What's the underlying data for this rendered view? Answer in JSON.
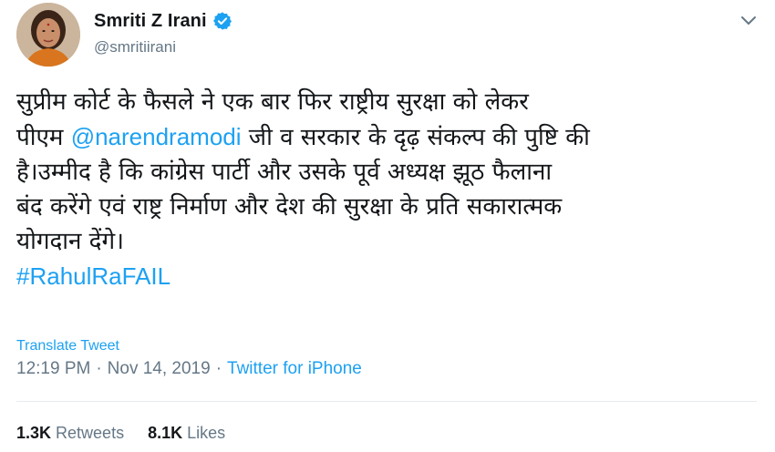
{
  "author": {
    "display_name": "Smriti Z Irani",
    "handle": "@smritiirani",
    "verified": true,
    "verified_color": "#1da1f2"
  },
  "tweet": {
    "lines": [
      {
        "segments": [
          {
            "type": "text",
            "value": "सुप्रीम कोर्ट के फैसले ने एक बार फिर राष्ट्रीय सुरक्षा को लेकर"
          }
        ]
      },
      {
        "segments": [
          {
            "type": "text",
            "value": "पीएम "
          },
          {
            "type": "mention",
            "value": "@narendramodi"
          },
          {
            "type": "text",
            "value": " जी व सरकार के दृढ़ संकल्प की पुष्टि की"
          }
        ]
      },
      {
        "segments": [
          {
            "type": "text",
            "value": "है।उम्मीद है कि कांग्रेस पार्टी और उसके पूर्व अध्यक्ष झूठ फैलाना"
          }
        ]
      },
      {
        "segments": [
          {
            "type": "text",
            "value": "बंद करेंगे एवं राष्ट्र निर्माण और देश की सुरक्षा के प्रति सकारात्मक"
          }
        ]
      },
      {
        "segments": [
          {
            "type": "text",
            "value": "योगदान देंगे।"
          }
        ]
      }
    ],
    "hashtag": "#RahulRaFAIL",
    "link_color": "#1da1f2"
  },
  "translate_label": "Translate Tweet",
  "meta": {
    "time": "12:19 PM",
    "separator": "·",
    "date": "Nov 14, 2019",
    "source": "Twitter for iPhone"
  },
  "stats": {
    "retweets_count": "1.3K",
    "retweets_label": "Retweets",
    "likes_count": "8.1K",
    "likes_label": "Likes"
  },
  "icons": {
    "verified": "verified-badge-icon",
    "caret": "chevron-down-icon"
  }
}
